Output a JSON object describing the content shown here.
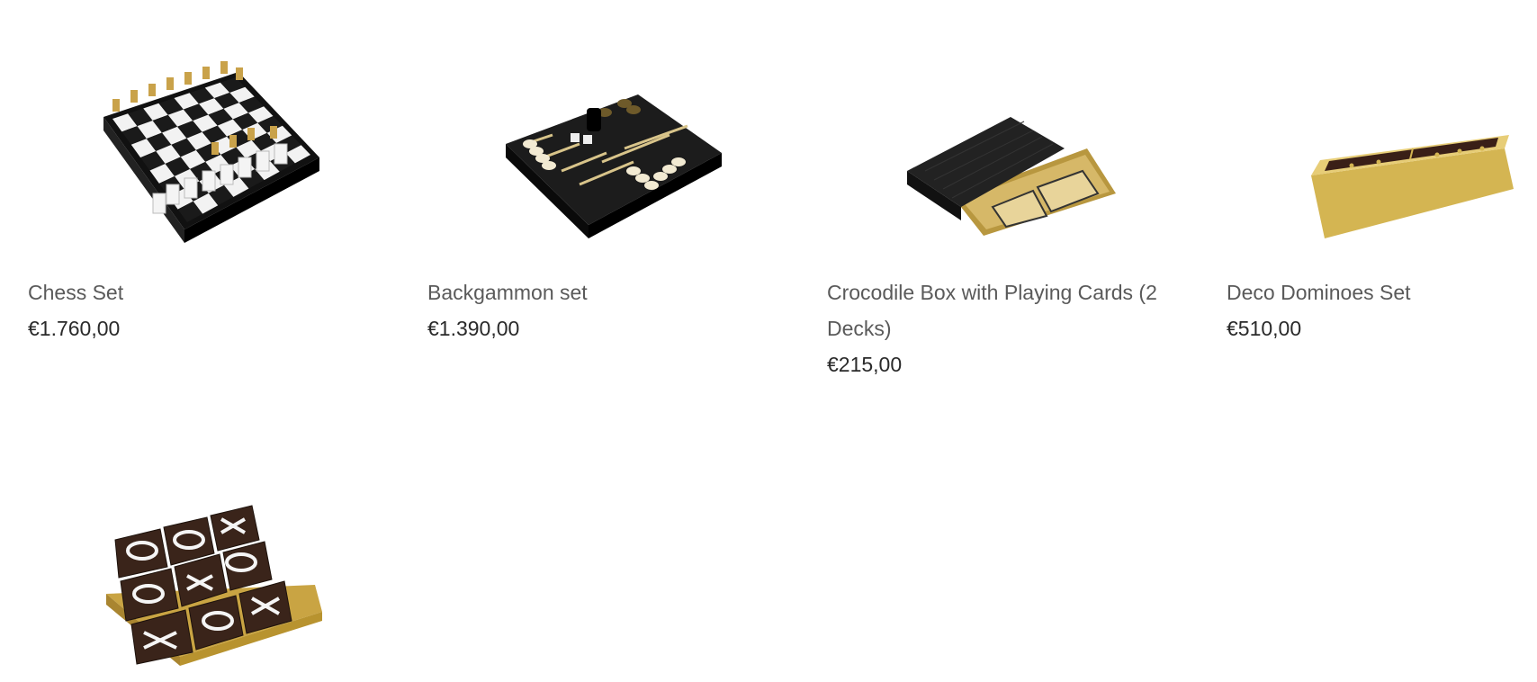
{
  "products": [
    {
      "title": "Chess Set",
      "price": "€1.760,00",
      "image": "chess-set-image"
    },
    {
      "title": "Backgammon set",
      "price": "€1.390,00",
      "image": "backgammon-set-image"
    },
    {
      "title": "Crocodile Box with Playing Cards (2 Decks)",
      "price": "€215,00",
      "image": "crocodile-box-cards-image"
    },
    {
      "title": "Deco Dominoes Set",
      "price": "€510,00",
      "image": "dominoes-set-image"
    },
    {
      "title": "",
      "price": "",
      "image": "tic-tac-toe-set-image"
    }
  ],
  "colors": {
    "title": "#5a5a5a",
    "price": "#2a2a2a",
    "gold": "#d9b65a",
    "black": "#1a1a1a"
  }
}
